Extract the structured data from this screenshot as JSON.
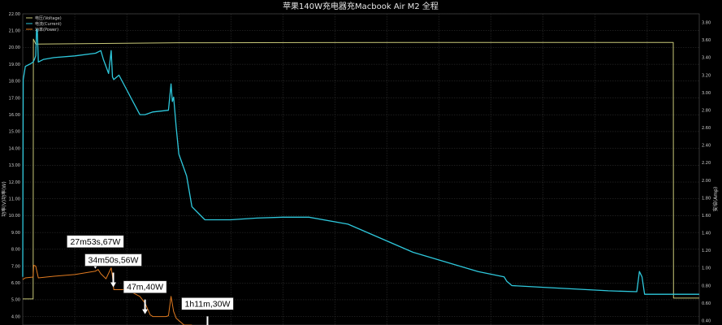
{
  "chart_data": {
    "type": "line",
    "title": "苹果140W充电器充Macbook Air M2 全程",
    "ylabel_left": "功率(V)功率(W)",
    "ylabel_right": "安培(Amp)",
    "left_axis": {
      "ylim": [
        3.5,
        22.0
      ],
      "ticks": [
        "4.00",
        "5.00",
        "6.00",
        "7.00",
        "8.00",
        "9.00",
        "10.00",
        "11.00",
        "12.00",
        "13.00",
        "14.00",
        "15.00",
        "16.00",
        "17.00",
        "18.00",
        "19.00",
        "20.00",
        "21.00",
        "22.00"
      ]
    },
    "right_axis": {
      "ylim": [
        0.35,
        3.9
      ],
      "ticks": [
        "0.40",
        "0.60",
        "0.80",
        "1.00",
        "1.20",
        "1.40",
        "1.60",
        "1.80",
        "2.00",
        "2.20",
        "2.40",
        "2.60",
        "2.80",
        "3.00",
        "3.20",
        "3.40",
        "3.60",
        "3.80"
      ]
    },
    "grid": true,
    "legend_position": "top-left",
    "series": [
      {
        "name": "电压(Voltage)",
        "axis": "left",
        "color": "#c8c878",
        "points": [
          [
            0,
            5.05
          ],
          [
            4,
            5.05
          ],
          [
            4.1,
            20.5
          ],
          [
            5,
            20.2
          ],
          [
            60,
            20.28
          ],
          [
            180,
            20.3
          ],
          [
            250,
            20.3
          ],
          [
            250.1,
            5.1
          ],
          [
            260,
            5.1
          ]
        ]
      },
      {
        "name": "电流(Current)",
        "axis": "right",
        "color": "#2ec8dc",
        "points": [
          [
            0,
            0.9
          ],
          [
            0.2,
            3.15
          ],
          [
            1,
            3.3
          ],
          [
            3,
            3.33
          ],
          [
            4,
            3.35
          ],
          [
            4.5,
            3.38
          ],
          [
            5,
            3.42
          ],
          [
            5.3,
            3.72
          ],
          [
            5.6,
            3.72
          ],
          [
            6,
            3.35
          ],
          [
            8,
            3.38
          ],
          [
            12,
            3.4
          ],
          [
            20,
            3.42
          ],
          [
            28,
            3.45
          ],
          [
            30,
            3.48
          ],
          [
            31,
            3.38
          ],
          [
            33,
            3.22
          ],
          [
            34,
            3.48
          ],
          [
            34.5,
            3.18
          ],
          [
            35,
            3.15
          ],
          [
            37,
            3.2
          ],
          [
            45,
            2.75
          ],
          [
            47,
            2.75
          ],
          [
            50,
            2.78
          ],
          [
            56,
            2.8
          ],
          [
            57,
            3.1
          ],
          [
            57.5,
            2.9
          ],
          [
            58,
            2.95
          ],
          [
            59,
            2.6
          ],
          [
            60,
            2.3
          ],
          [
            63,
            2.05
          ],
          [
            65,
            1.7
          ],
          [
            70,
            1.55
          ],
          [
            80,
            1.55
          ],
          [
            90,
            1.57
          ],
          [
            100,
            1.58
          ],
          [
            110,
            1.58
          ],
          [
            125,
            1.5
          ],
          [
            150,
            1.18
          ],
          [
            175,
            0.96
          ],
          [
            185,
            0.9
          ],
          [
            186,
            0.85
          ],
          [
            188,
            0.8
          ],
          [
            200,
            0.78
          ],
          [
            225,
            0.74
          ],
          [
            236,
            0.73
          ],
          [
            237,
            0.96
          ],
          [
            238,
            0.9
          ],
          [
            239,
            0.7
          ],
          [
            250,
            0.7
          ],
          [
            260,
            0.7
          ]
        ]
      },
      {
        "name": "功率(Power)",
        "axis": "left",
        "color": "#e07a20",
        "points": [
          [
            0,
            6.2
          ],
          [
            1,
            6.3
          ],
          [
            4,
            6.35
          ],
          [
            4.2,
            7.05
          ],
          [
            5,
            7.0
          ],
          [
            6,
            6.3
          ],
          [
            12,
            6.4
          ],
          [
            20,
            6.5
          ],
          [
            27.9,
            6.7
          ],
          [
            29,
            6.8
          ],
          [
            30,
            6.55
          ],
          [
            31,
            6.4
          ],
          [
            32,
            6.25
          ],
          [
            34,
            6.9
          ],
          [
            34.5,
            6.4
          ],
          [
            35,
            5.6
          ],
          [
            40,
            5.6
          ],
          [
            45,
            5.2
          ],
          [
            47,
            4.8
          ],
          [
            49,
            4.1
          ],
          [
            50,
            4.0
          ],
          [
            55,
            4.0
          ],
          [
            56,
            4.05
          ],
          [
            57,
            5.2
          ],
          [
            58,
            4.3
          ],
          [
            59,
            3.9
          ],
          [
            62,
            3.5
          ],
          [
            65,
            3.5
          ]
        ]
      }
    ],
    "annotations": [
      {
        "text": "27m53s,67W",
        "x": 27.9,
        "y": 6.7
      },
      {
        "text": "34m50s,56W",
        "x": 34.8,
        "y": 5.6
      },
      {
        "text": "47m,40W",
        "x": 47,
        "y": 4.0
      },
      {
        "text": "1h11m,30W",
        "x": 71,
        "y": 3.0
      }
    ]
  }
}
